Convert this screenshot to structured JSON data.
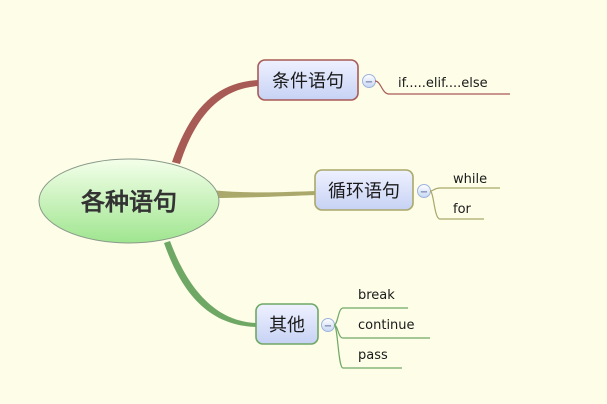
{
  "root": {
    "label": "各种语句"
  },
  "branches": [
    {
      "label": "条件语句",
      "color": "#a85a55",
      "collapse_glyph": "−",
      "children": [
        "if.....elif....else"
      ]
    },
    {
      "label": "循环语句",
      "color": "#aaa86a",
      "collapse_glyph": "−",
      "children": [
        "while",
        "for"
      ]
    },
    {
      "label": "其他",
      "color": "#6fa865",
      "collapse_glyph": "−",
      "children": [
        "break",
        "continue",
        "pass"
      ]
    }
  ]
}
